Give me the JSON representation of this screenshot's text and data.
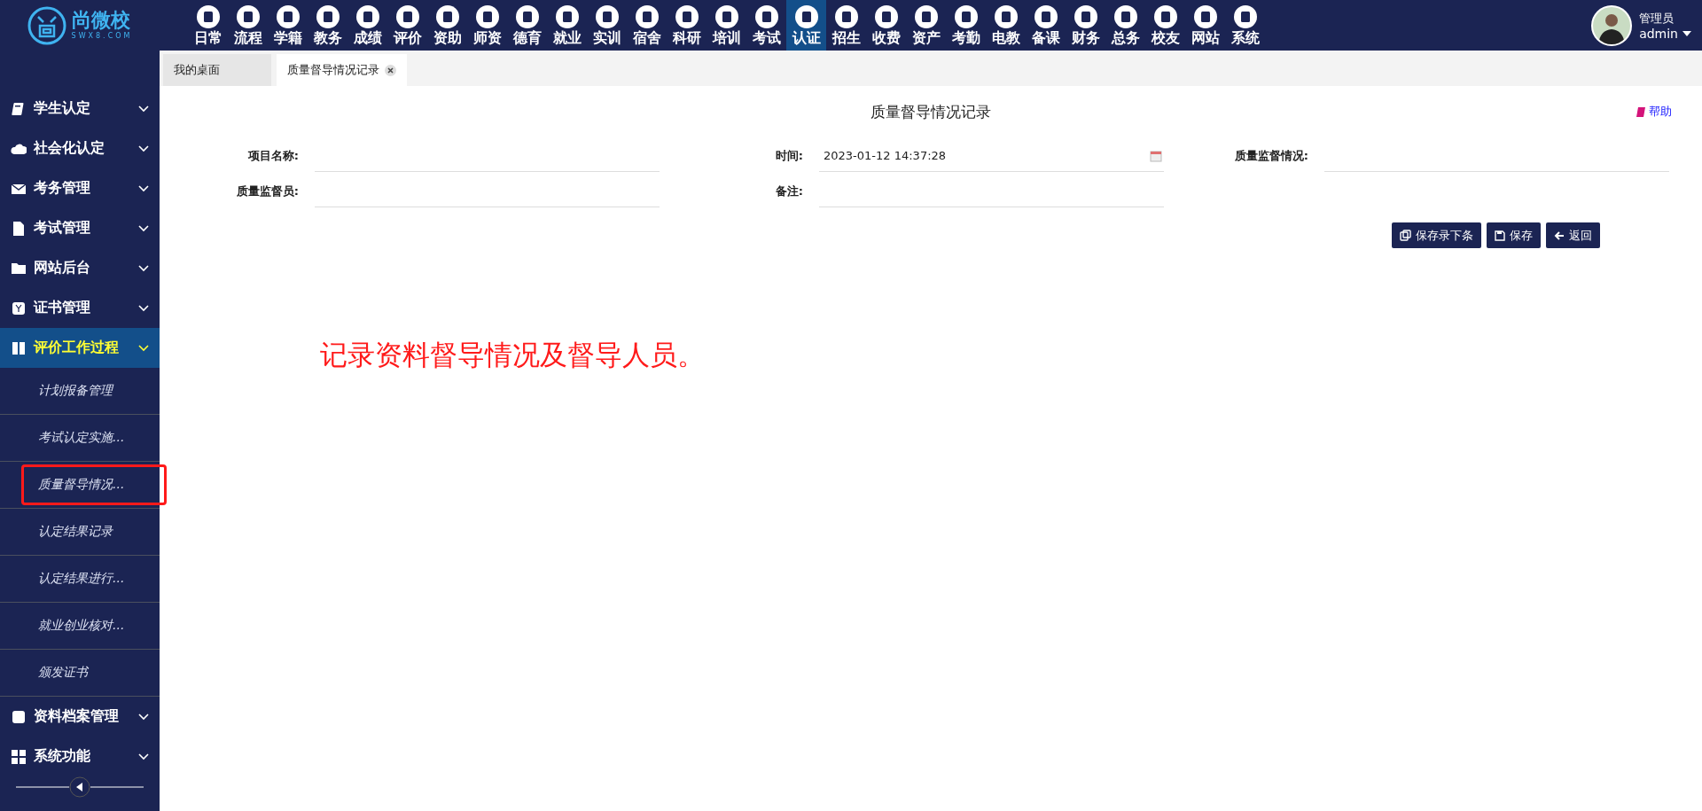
{
  "header": {
    "logo": {
      "name": "尚微校",
      "domain": "SWX8.COM"
    },
    "nav": [
      {
        "label": "日常",
        "selected": false
      },
      {
        "label": "流程",
        "selected": false
      },
      {
        "label": "学籍",
        "selected": false
      },
      {
        "label": "教务",
        "selected": false
      },
      {
        "label": "成绩",
        "selected": false
      },
      {
        "label": "评价",
        "selected": false
      },
      {
        "label": "资助",
        "selected": false
      },
      {
        "label": "师资",
        "selected": false
      },
      {
        "label": "德育",
        "selected": false
      },
      {
        "label": "就业",
        "selected": false
      },
      {
        "label": "实训",
        "selected": false
      },
      {
        "label": "宿舍",
        "selected": false
      },
      {
        "label": "科研",
        "selected": false
      },
      {
        "label": "培训",
        "selected": false
      },
      {
        "label": "考试",
        "selected": false
      },
      {
        "label": "认证",
        "selected": true
      },
      {
        "label": "招生",
        "selected": false
      },
      {
        "label": "收费",
        "selected": false
      },
      {
        "label": "资产",
        "selected": false
      },
      {
        "label": "考勤",
        "selected": false
      },
      {
        "label": "电教",
        "selected": false
      },
      {
        "label": "备课",
        "selected": false
      },
      {
        "label": "财务",
        "selected": false
      },
      {
        "label": "总务",
        "selected": false
      },
      {
        "label": "校友",
        "selected": false
      },
      {
        "label": "网站",
        "selected": false
      },
      {
        "label": "系统",
        "selected": false
      }
    ],
    "user": {
      "role": "管理员",
      "name": "admin"
    }
  },
  "tabs": [
    {
      "label": "我的桌面",
      "selected": false,
      "closable": false
    },
    {
      "label": "质量督导情况记录",
      "selected": true,
      "closable": true
    }
  ],
  "sidebar": {
    "items": [
      {
        "label": "学生认定",
        "selected": false
      },
      {
        "label": "社会化认定",
        "selected": false
      },
      {
        "label": "考务管理",
        "selected": false
      },
      {
        "label": "考试管理",
        "selected": false
      },
      {
        "label": "网站后台",
        "selected": false
      },
      {
        "label": "证书管理",
        "selected": false
      },
      {
        "label": "评价工作过程",
        "selected": true,
        "children": [
          {
            "label": "计划报备管理",
            "highlighted": false
          },
          {
            "label": "考试认定实施...",
            "highlighted": false
          },
          {
            "label": "质量督导情况...",
            "highlighted": true
          },
          {
            "label": "认定结果记录",
            "highlighted": false
          },
          {
            "label": "认定结果进行...",
            "highlighted": false
          },
          {
            "label": "就业创业核对...",
            "highlighted": false
          },
          {
            "label": "颁发证书",
            "highlighted": false
          }
        ]
      },
      {
        "label": "资料档案管理",
        "selected": false
      },
      {
        "label": "系统功能",
        "selected": false
      }
    ]
  },
  "form": {
    "title": "质量督导情况记录",
    "help": "帮助",
    "fields": [
      {
        "label": "项目名称:",
        "kind": "text"
      },
      {
        "label": "时间:",
        "value": "2023-01-12 14:37:28",
        "kind": "date"
      },
      {
        "label": "质量监督情况:",
        "kind": "text"
      },
      {
        "label": "质量监督员:",
        "kind": "text"
      },
      {
        "label": "备注:",
        "kind": "text"
      }
    ],
    "buttons": [
      {
        "label": "保存录下条",
        "kind": "save-next"
      },
      {
        "label": "保存",
        "kind": "save"
      },
      {
        "label": "返回",
        "kind": "back"
      }
    ]
  },
  "annotation": "记录资料督导情况及督导人员。"
}
